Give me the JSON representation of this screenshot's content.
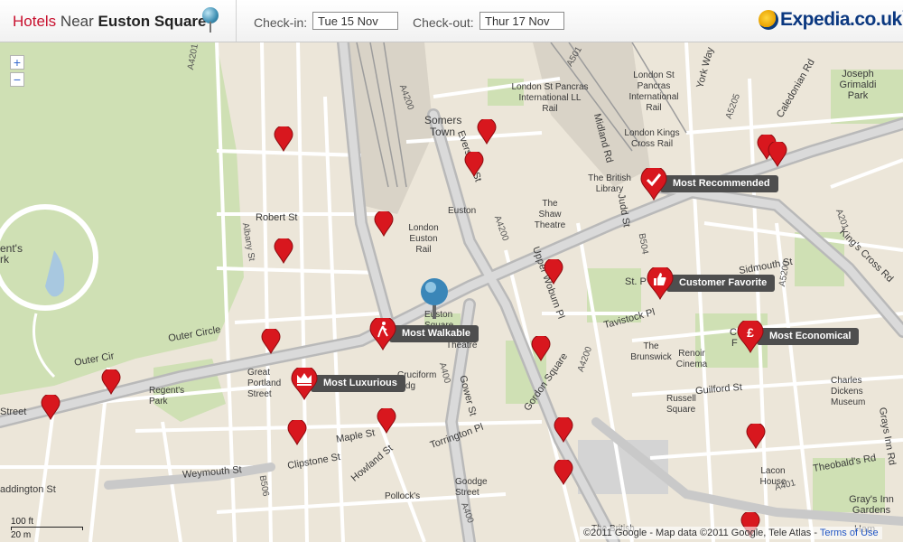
{
  "header": {
    "title_hotels": "Hotels",
    "title_near": "Near",
    "title_place": "Euston Square",
    "checkin_label": "Check-in:",
    "checkin_value": "Tue 15 Nov",
    "checkout_label": "Check-out:",
    "checkout_value": "Thur 17 Nov",
    "brand": "Expedia.co.uk",
    "brand_tm": "™"
  },
  "map_controls": {
    "zoom_in": "+",
    "zoom_out": "−"
  },
  "badges": {
    "most_recommended": "Most Recommended",
    "customer_favorite": "Customer Favorite",
    "most_economical": "Most Economical",
    "most_walkable": "Most Walkable",
    "most_luxurious": "Most Luxurious"
  },
  "labels": {
    "somers_town": "Somers Town",
    "euston": "Euston",
    "london_euston_rail": "London Euston Rail",
    "euston_square": "Euston Square",
    "london_st_pancras_ll": "London St Pancras International LL Rail",
    "london_st_pancras": "London St Pancras International Rail",
    "london_kings_cross": "London Kings Cross Rail",
    "british_library": "The British Library",
    "shaw_theatre": "The Shaw Theatre",
    "joseph_grimaldi": "Joseph Grimaldi Park",
    "robert_st": "Robert St",
    "albany_st": "Albany St",
    "outer_circle": "Outer Cir",
    "outer_circle2": "Outer Circle",
    "regents_park_station": "Regent's Park",
    "great_portland_street": "Great Portland Street",
    "cruciform_bldg": "Cruciform Bldg",
    "theatre": "Theatre",
    "pollocks": "Pollock's",
    "goodge_street": "Goodge Street",
    "weymouth_st": "Weymouth St",
    "clipstone_st": "Clipstone St",
    "maple_st": "Maple St",
    "howland_st": "Howland St",
    "torrington_pl": "Torrington Pl",
    "gower_st": "Gower St",
    "gordon_square": "Gordon Square",
    "upper_woburn_pl": "Upper Woburn Pl",
    "tavistock_pl": "Tavistock Pl",
    "st_p": "St. P",
    "brunswick": "The Brunswick",
    "renoir": "Renoir Cinema",
    "russell_square": "Russell Square",
    "guilford_st": "Guilford St",
    "charles_dickens": "Charles Dickens Museum",
    "sidmouth_st": "Sidmouth St",
    "lacon_house": "Lacon House",
    "theobalds_rd": "Theobald's Rd",
    "grays_inn_gardens": "Gray's Inn Gardens",
    "grays_inn_rd": "Grays Inn Rd",
    "kings_cross_rd": "King's Cross Rd",
    "caledonian_rd": "Caledonian Rd",
    "york_way": "York Way",
    "midland_rd": "Midland Rd",
    "judd_st": "Judd St",
    "eversholt_st": "Eversholt St",
    "regents_park_left": "ent's rk",
    "street_left": "Street",
    "paddington_st": "addington St",
    "british_bottom": "The British",
    "ham": "Ham",
    "road_a4201": "A4201",
    "road_a400": "A400",
    "road_a4200": "A4200",
    "road_a501": "A501",
    "road_a5200": "A5200",
    "road_a5205": "A5205",
    "road_a201": "A201",
    "road_a401": "A401",
    "road_b504": "B504",
    "road_b506": "B506",
    "c": "C",
    "f": "F"
  },
  "scale": {
    "top": "100 ft",
    "bottom": "20 m"
  },
  "footer": {
    "copyright": "©2011 Google - Map data ©2011 Google, Tele Atlas -",
    "terms": "Terms of Use"
  },
  "colors": {
    "brand_red": "#c8102e",
    "pin_red": "#d8171e",
    "park_green": "#cfe0b4",
    "water": "#a8c8e0"
  }
}
